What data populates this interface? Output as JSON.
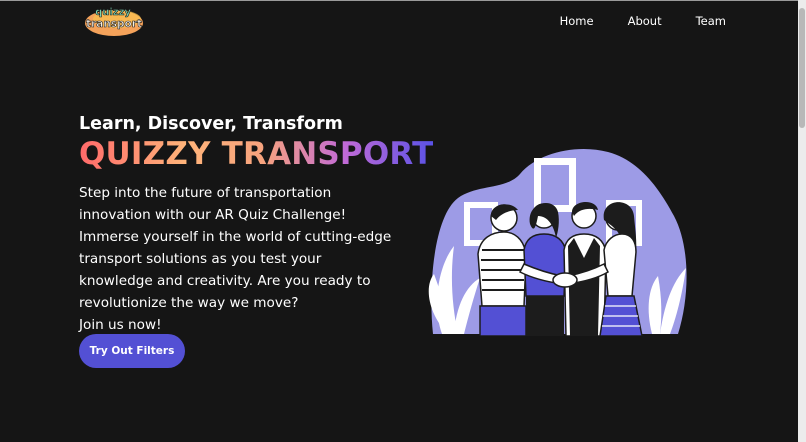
{
  "header": {
    "logo": {
      "line1": "quizzy",
      "line2": "transport"
    },
    "nav": [
      {
        "label": "Home"
      },
      {
        "label": "About"
      },
      {
        "label": "Team"
      }
    ]
  },
  "hero": {
    "subtitle": "Learn, Discover, Transform",
    "title": "QUIZZY TRANSPORT",
    "description": "Step into the future of transportation innovation with our AR Quiz Challenge! Immerse yourself in the world of cutting-edge transport solutions as you test your knowledge and creativity. Are you ready to revolutionize the way we move?",
    "join": "Join us now!",
    "cta_label": "Try Out Filters"
  },
  "colors": {
    "background": "#151515",
    "accent": "#5350d4",
    "illustration": "#9d9be6",
    "gradient": [
      "#ff6a6a",
      "#ffb47a",
      "#c16ad6",
      "#5a52e6"
    ]
  }
}
